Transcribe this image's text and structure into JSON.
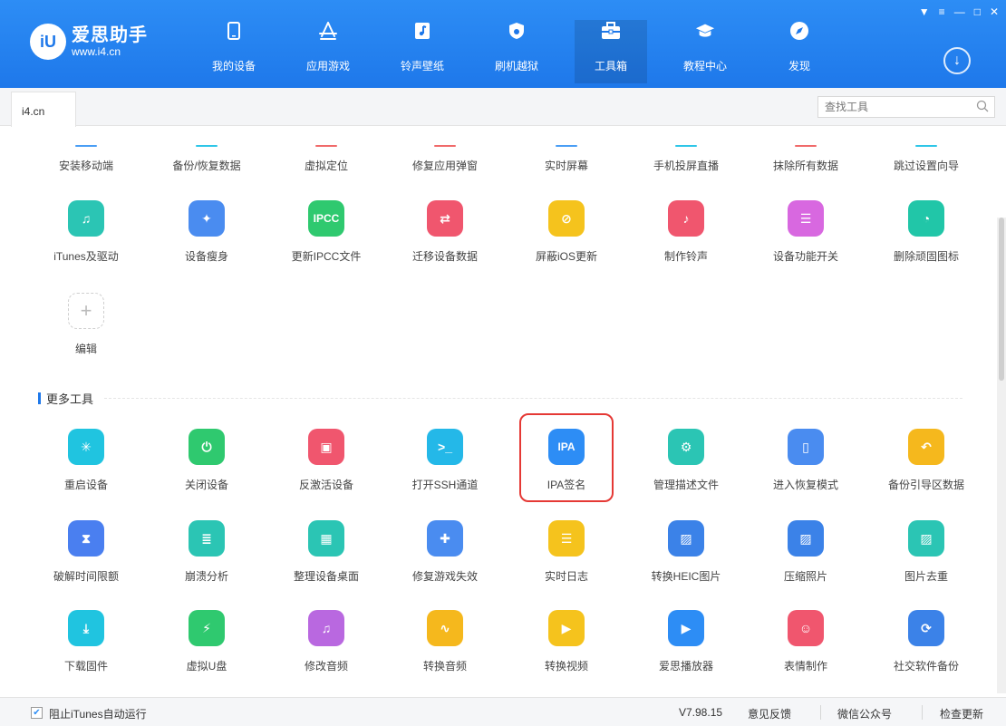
{
  "app": {
    "name": "爱思助手",
    "url": "www.i4.cn",
    "brand_color": "#1e78ea"
  },
  "nav": [
    {
      "label": "我的设备",
      "icon": "phone-icon"
    },
    {
      "label": "应用游戏",
      "icon": "app-store-icon"
    },
    {
      "label": "铃声壁纸",
      "icon": "music-icon"
    },
    {
      "label": "刷机越狱",
      "icon": "shield-icon"
    },
    {
      "label": "工具箱",
      "icon": "toolbox-icon",
      "active": true
    },
    {
      "label": "教程中心",
      "icon": "graduation-cap-icon"
    },
    {
      "label": "发现",
      "icon": "compass-icon"
    }
  ],
  "tabs": {
    "current": "i4.cn"
  },
  "search": {
    "placeholder": "查找工具"
  },
  "top_tools": [
    {
      "label": "安装移动端",
      "color": "#4a9ef5"
    },
    {
      "label": "备份/恢复数据",
      "color": "#2fc6e8"
    },
    {
      "label": "虚拟定位",
      "color": "#f06a6a"
    },
    {
      "label": "修复应用弹窗",
      "color": "#f06a6a"
    },
    {
      "label": "实时屏幕",
      "color": "#4a9ef5"
    },
    {
      "label": "手机投屏直播",
      "color": "#2fc6e8"
    },
    {
      "label": "抹除所有数据",
      "color": "#f06a6a"
    },
    {
      "label": "跳过设置向导",
      "color": "#2fc6e8"
    }
  ],
  "tools_row2": [
    {
      "label": "iTunes及驱动",
      "color": "#2bc5b4",
      "glyph": "♫"
    },
    {
      "label": "设备瘦身",
      "color": "#4a8cf0",
      "glyph": "✦"
    },
    {
      "label": "更新IPCC文件",
      "color": "#2fc96f",
      "glyph": "IPCC"
    },
    {
      "label": "迁移设备数据",
      "color": "#f0566e",
      "glyph": "⇄"
    },
    {
      "label": "屏蔽iOS更新",
      "color": "#f5c31d",
      "glyph": "⊘"
    },
    {
      "label": "制作铃声",
      "color": "#f0566e",
      "glyph": "♪"
    },
    {
      "label": "设备功能开关",
      "color": "#d868e0",
      "glyph": "☰"
    },
    {
      "label": "删除顽固图标",
      "color": "#21c6a8",
      "glyph": "◔"
    }
  ],
  "edit_tool": {
    "label": "编辑",
    "glyph": "+"
  },
  "more_section": {
    "title": "更多工具"
  },
  "more_tools": [
    [
      {
        "label": "重启设备",
        "color": "#20c4e0",
        "glyph": "✳"
      },
      {
        "label": "关闭设备",
        "color": "#2fc96f",
        "glyph": "⏻"
      },
      {
        "label": "反激活设备",
        "color": "#f0566e",
        "glyph": "▣"
      },
      {
        "label": "打开SSH通道",
        "color": "#24b8e8",
        "glyph": ">_"
      },
      {
        "label": "IPA签名",
        "color": "#2d8df5",
        "glyph": "IPA"
      },
      {
        "label": "管理描述文件",
        "color": "#2bc5b4",
        "glyph": "⚙"
      },
      {
        "label": "进入恢复模式",
        "color": "#4a8cf0",
        "glyph": "▯"
      },
      {
        "label": "备份引导区数据",
        "color": "#f5b81d",
        "glyph": "↶"
      }
    ],
    [
      {
        "label": "破解时间限额",
        "color": "#4a7ff0",
        "glyph": "⧗"
      },
      {
        "label": "崩溃分析",
        "color": "#2bc5b4",
        "glyph": "≣"
      },
      {
        "label": "整理设备桌面",
        "color": "#2bc5b4",
        "glyph": "▦"
      },
      {
        "label": "修复游戏失效",
        "color": "#4a8cf0",
        "glyph": "✚"
      },
      {
        "label": "实时日志",
        "color": "#f5c31d",
        "glyph": "☰"
      },
      {
        "label": "转换HEIC图片",
        "color": "#3b82e8",
        "glyph": "▨"
      },
      {
        "label": "压缩照片",
        "color": "#3b82e8",
        "glyph": "▨"
      },
      {
        "label": "图片去重",
        "color": "#2bc5b4",
        "glyph": "▨"
      }
    ],
    [
      {
        "label": "下载固件",
        "color": "#20c4e0",
        "glyph": "⤓"
      },
      {
        "label": "虚拟U盘",
        "color": "#2fc96f",
        "glyph": "⚡"
      },
      {
        "label": "修改音频",
        "color": "#b968e0",
        "glyph": "♫"
      },
      {
        "label": "转换音频",
        "color": "#f5b81d",
        "glyph": "∿"
      },
      {
        "label": "转换视频",
        "color": "#f5c31d",
        "glyph": "▶"
      },
      {
        "label": "爱思播放器",
        "color": "#2d8df5",
        "glyph": "▶"
      },
      {
        "label": "表情制作",
        "color": "#f0566e",
        "glyph": "☺"
      },
      {
        "label": "社交软件备份",
        "color": "#3b82e8",
        "glyph": "⟳"
      }
    ]
  ],
  "footer": {
    "itunes_label": "阻止iTunes自动运行",
    "itunes_checked": true,
    "version": "V7.98.15",
    "feedback": "意见反馈",
    "wechat": "微信公众号",
    "update": "检查更新"
  }
}
